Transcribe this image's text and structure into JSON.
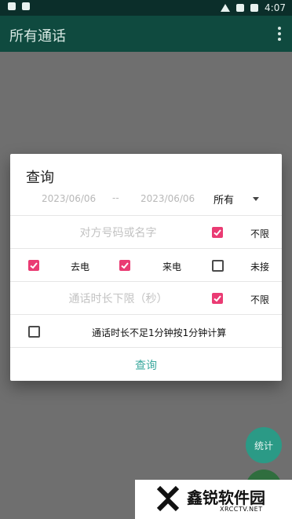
{
  "status_bar": {
    "time": "4:07",
    "left_icons": [
      "shield-icon",
      "a-icon"
    ],
    "right_icons": [
      "wifi-icon",
      "sim-icon",
      "battery-icon"
    ]
  },
  "app_bar": {
    "title": "所有通话",
    "menu_icon": "more-vert-icon"
  },
  "dialog": {
    "title": "查询",
    "date_start": "2023/06/06",
    "date_sep": "--",
    "date_end": "2023/06/06",
    "type_select": "所有",
    "contact_placeholder": "对方号码或名字",
    "contact_checkbox_label": "不限",
    "call_types": [
      {
        "label": "去电",
        "checked": true
      },
      {
        "label": "来电",
        "checked": true
      },
      {
        "label": "未接",
        "checked": false
      }
    ],
    "duration_placeholder": "通话时长下限（秒）",
    "duration_checkbox_label": "不限",
    "round_label": "通话时长不足1分钟按1分钟计算",
    "round_checked": false,
    "query_button": "查询"
  },
  "fab": {
    "stats_label": "统计"
  },
  "watermark": {
    "brand": "鑫锐软件园",
    "domain": "XRCCTV.NET"
  },
  "colors": {
    "accent": "#ea3b73",
    "teal": "#3aa89d",
    "appbar": "#0f4a3f",
    "status": "#0b2e2a"
  }
}
